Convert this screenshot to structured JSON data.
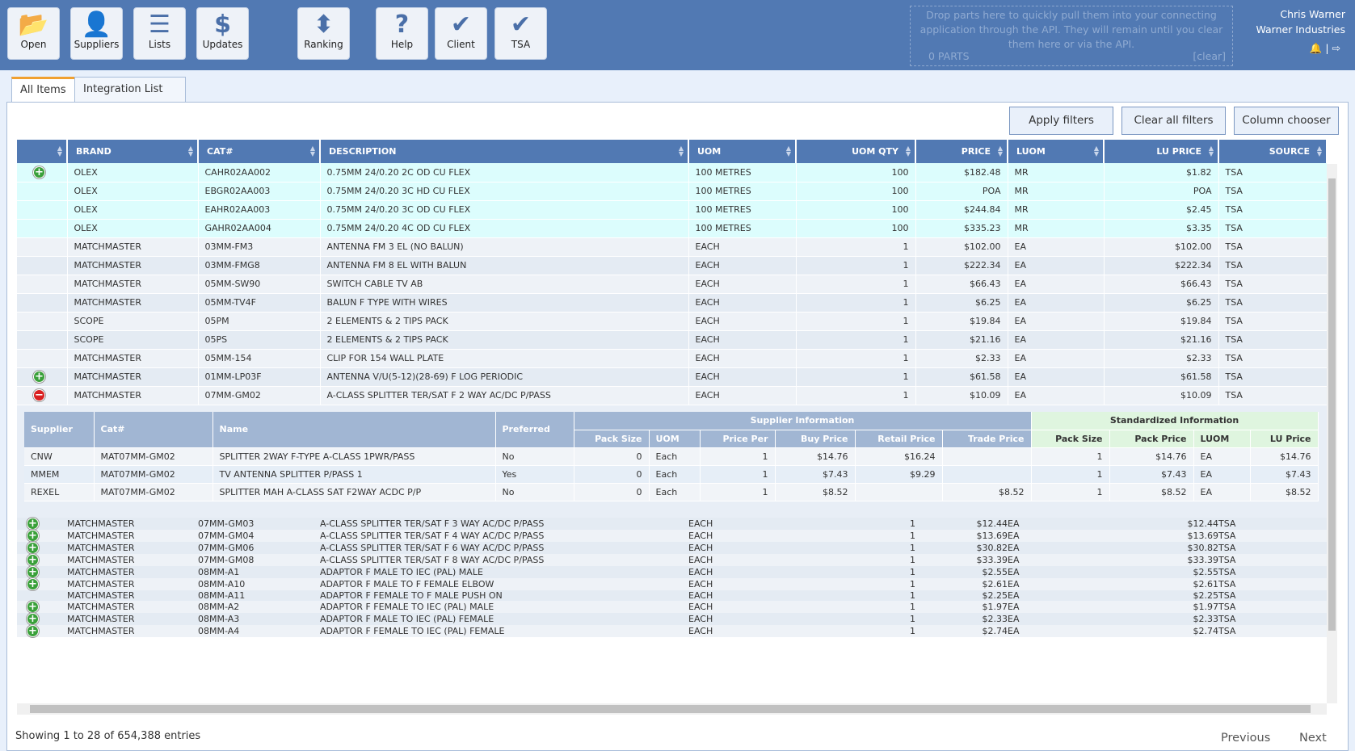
{
  "toolbar": {
    "buttons": [
      {
        "label": "Open",
        "icon": "folder-open-icon",
        "glyph": "📂"
      },
      {
        "label": "Suppliers",
        "icon": "user-icon",
        "glyph": "👤"
      },
      {
        "label": "Lists",
        "icon": "list-icon",
        "glyph": "☰"
      },
      {
        "label": "Updates",
        "icon": "dollar-icon",
        "glyph": "$"
      },
      {
        "label": "Ranking",
        "icon": "sort-icon",
        "glyph": "⬍"
      },
      {
        "label": "Help",
        "icon": "question-icon",
        "glyph": "?"
      },
      {
        "label": "Client",
        "icon": "check-icon",
        "glyph": "✔"
      },
      {
        "label": "TSA",
        "icon": "check-icon",
        "glyph": "✔"
      }
    ]
  },
  "dropzone": {
    "text": "Drop parts here to quickly pull them into your connecting application through the API. They will remain until you clear them here or via the API.",
    "count": "0 PARTS",
    "clear": "[clear]"
  },
  "user": {
    "name": "Chris Warner",
    "company": "Warner Industries",
    "bell": "🔔",
    "sep": "|",
    "logout": "⇨"
  },
  "tabs": {
    "all_items": "All Items",
    "integration_list": "Integration List",
    "chevron": "⌄"
  },
  "filters": {
    "apply": "Apply filters",
    "clear": "Clear all filters",
    "columns": "Column chooser"
  },
  "columns": [
    "",
    "BRAND",
    "CAT#",
    "DESCRIPTION",
    "UOM",
    "UOM QTY",
    "PRICE",
    "LUOM",
    "LU PRICE",
    "SOURCE"
  ],
  "rows_top": [
    {
      "icon": "plus",
      "brand": "OLEX",
      "cat": "CAHR02AA002",
      "desc": "0.75MM 24/0.20 2C OD CU FLEX",
      "uom": "100 METRES",
      "qty": "100",
      "price": "$182.48",
      "luom": "MR",
      "lu": "$1.82",
      "src": "TSA",
      "hl": true
    },
    {
      "icon": "",
      "brand": "OLEX",
      "cat": "EBGR02AA003",
      "desc": "0.75MM 24/0.20 3C HD CU FLEX",
      "uom": "100 METRES",
      "qty": "100",
      "price": "POA",
      "luom": "MR",
      "lu": "POA",
      "src": "TSA",
      "hl": true
    },
    {
      "icon": "",
      "brand": "OLEX",
      "cat": "EAHR02AA003",
      "desc": "0.75MM 24/0.20 3C OD CU FLEX",
      "uom": "100 METRES",
      "qty": "100",
      "price": "$244.84",
      "luom": "MR",
      "lu": "$2.45",
      "src": "TSA",
      "hl": true
    },
    {
      "icon": "",
      "brand": "OLEX",
      "cat": "GAHR02AA004",
      "desc": "0.75MM 24/0.20 4C OD CU FLEX",
      "uom": "100 METRES",
      "qty": "100",
      "price": "$335.23",
      "luom": "MR",
      "lu": "$3.35",
      "src": "TSA",
      "hl": true
    },
    {
      "icon": "",
      "brand": "MATCHMASTER",
      "cat": "03MM-FM3",
      "desc": "ANTENNA FM 3 EL (NO BALUN)",
      "uom": "EACH",
      "qty": "1",
      "price": "$102.00",
      "luom": "EA",
      "lu": "$102.00",
      "src": "TSA"
    },
    {
      "icon": "",
      "brand": "MATCHMASTER",
      "cat": "03MM-FMG8",
      "desc": "ANTENNA FM 8 EL WITH BALUN",
      "uom": "EACH",
      "qty": "1",
      "price": "$222.34",
      "luom": "EA",
      "lu": "$222.34",
      "src": "TSA"
    },
    {
      "icon": "",
      "brand": "MATCHMASTER",
      "cat": "05MM-SW90",
      "desc": "SWITCH CABLE TV AB",
      "uom": "EACH",
      "qty": "1",
      "price": "$66.43",
      "luom": "EA",
      "lu": "$66.43",
      "src": "TSA"
    },
    {
      "icon": "",
      "brand": "MATCHMASTER",
      "cat": "05MM-TV4F",
      "desc": "BALUN F TYPE WITH WIRES",
      "uom": "EACH",
      "qty": "1",
      "price": "$6.25",
      "luom": "EA",
      "lu": "$6.25",
      "src": "TSA"
    },
    {
      "icon": "",
      "brand": "SCOPE",
      "cat": "05PM",
      "desc": "2 ELEMENTS & 2 TIPS PACK",
      "uom": "EACH",
      "qty": "1",
      "price": "$19.84",
      "luom": "EA",
      "lu": "$19.84",
      "src": "TSA"
    },
    {
      "icon": "",
      "brand": "SCOPE",
      "cat": "05PS",
      "desc": "2 ELEMENTS & 2 TIPS PACK",
      "uom": "EACH",
      "qty": "1",
      "price": "$21.16",
      "luom": "EA",
      "lu": "$21.16",
      "src": "TSA"
    },
    {
      "icon": "",
      "brand": "MATCHMASTER",
      "cat": "05MM-154",
      "desc": "CLIP FOR 154 WALL PLATE",
      "uom": "EACH",
      "qty": "1",
      "price": "$2.33",
      "luom": "EA",
      "lu": "$2.33",
      "src": "TSA"
    },
    {
      "icon": "plus",
      "brand": "MATCHMASTER",
      "cat": "01MM-LP03F",
      "desc": "ANTENNA V/U(5-12)(28-69) F LOG PERIODIC",
      "uom": "EACH",
      "qty": "1",
      "price": "$61.58",
      "luom": "EA",
      "lu": "$61.58",
      "src": "TSA"
    },
    {
      "icon": "minus",
      "brand": "MATCHMASTER",
      "cat": "07MM-GM02",
      "desc": "A-CLASS SPLITTER TER/SAT F 2 WAY AC/DC P/PASS",
      "uom": "EACH",
      "qty": "1",
      "price": "$10.09",
      "luom": "EA",
      "lu": "$10.09",
      "src": "TSA"
    }
  ],
  "detail": {
    "group_supplier": "Supplier Information",
    "group_std": "Standardized Information",
    "headers": [
      "Supplier",
      "Cat#",
      "Name",
      "Preferred",
      "Pack Size",
      "UOM",
      "Price Per",
      "Buy Price",
      "Retail Price",
      "Trade Price",
      "Pack Size",
      "Pack Price",
      "LUOM",
      "LU Price"
    ],
    "rows": [
      [
        "CNW",
        "MAT07MM-GM02",
        "SPLITTER 2WAY F-TYPE A-CLASS 1PWR/PASS",
        "No",
        "0",
        "Each",
        "1",
        "$14.76",
        "$16.24",
        "",
        "1",
        "$14.76",
        "EA",
        "$14.76"
      ],
      [
        "MMEM",
        "MAT07MM-GM02",
        "TV ANTENNA SPLITTER P/PASS 1",
        "Yes",
        "0",
        "Each",
        "1",
        "$7.43",
        "$9.29",
        "",
        "1",
        "$7.43",
        "EA",
        "$7.43"
      ],
      [
        "REXEL",
        "MAT07MM-GM02",
        "SPLITTER MAH A-CLASS SAT F2WAY ACDC P/P",
        "No",
        "0",
        "Each",
        "1",
        "$8.52",
        "",
        "$8.52",
        "1",
        "$8.52",
        "EA",
        "$8.52"
      ]
    ]
  },
  "rows_bottom": [
    {
      "icon": "plus",
      "brand": "MATCHMASTER",
      "cat": "07MM-GM03",
      "desc": "A-CLASS SPLITTER TER/SAT F 3 WAY AC/DC P/PASS",
      "uom": "EACH",
      "qty": "1",
      "price": "$12.44",
      "luom": "EA",
      "lu": "$12.44",
      "src": "TSA"
    },
    {
      "icon": "plus",
      "brand": "MATCHMASTER",
      "cat": "07MM-GM04",
      "desc": "A-CLASS SPLITTER TER/SAT F 4 WAY AC/DC P/PASS",
      "uom": "EACH",
      "qty": "1",
      "price": "$13.69",
      "luom": "EA",
      "lu": "$13.69",
      "src": "TSA"
    },
    {
      "icon": "plus",
      "brand": "MATCHMASTER",
      "cat": "07MM-GM06",
      "desc": "A-CLASS SPLITTER TER/SAT F 6 WAY AC/DC P/PASS",
      "uom": "EACH",
      "qty": "1",
      "price": "$30.82",
      "luom": "EA",
      "lu": "$30.82",
      "src": "TSA"
    },
    {
      "icon": "plus",
      "brand": "MATCHMASTER",
      "cat": "07MM-GM08",
      "desc": "A-CLASS SPLITTER TER/SAT F 8 WAY AC/DC P/PASS",
      "uom": "EACH",
      "qty": "1",
      "price": "$33.39",
      "luom": "EA",
      "lu": "$33.39",
      "src": "TSA"
    },
    {
      "icon": "plus",
      "brand": "MATCHMASTER",
      "cat": "08MM-A1",
      "desc": "ADAPTOR F MALE TO IEC (PAL) MALE",
      "uom": "EACH",
      "qty": "1",
      "price": "$2.55",
      "luom": "EA",
      "lu": "$2.55",
      "src": "TSA"
    },
    {
      "icon": "plus",
      "brand": "MATCHMASTER",
      "cat": "08MM-A10",
      "desc": "ADAPTOR F MALE TO F FEMALE ELBOW",
      "uom": "EACH",
      "qty": "1",
      "price": "$2.61",
      "luom": "EA",
      "lu": "$2.61",
      "src": "TSA"
    },
    {
      "icon": "",
      "brand": "MATCHMASTER",
      "cat": "08MM-A11",
      "desc": "ADAPTOR F FEMALE TO F MALE PUSH ON",
      "uom": "EACH",
      "qty": "1",
      "price": "$2.25",
      "luom": "EA",
      "lu": "$2.25",
      "src": "TSA"
    },
    {
      "icon": "plus",
      "brand": "MATCHMASTER",
      "cat": "08MM-A2",
      "desc": "ADAPTOR F FEMALE TO IEC (PAL) MALE",
      "uom": "EACH",
      "qty": "1",
      "price": "$1.97",
      "luom": "EA",
      "lu": "$1.97",
      "src": "TSA"
    },
    {
      "icon": "plus",
      "brand": "MATCHMASTER",
      "cat": "08MM-A3",
      "desc": "ADAPTOR F MALE TO IEC (PAL) FEMALE",
      "uom": "EACH",
      "qty": "1",
      "price": "$2.33",
      "luom": "EA",
      "lu": "$2.33",
      "src": "TSA"
    },
    {
      "icon": "plus",
      "brand": "MATCHMASTER",
      "cat": "08MM-A4",
      "desc": "ADAPTOR F FEMALE TO IEC (PAL) FEMALE",
      "uom": "EACH",
      "qty": "1",
      "price": "$2.74",
      "luom": "EA",
      "lu": "$2.74",
      "src": "TSA"
    }
  ],
  "footer": {
    "info": "Showing 1 to 28 of 654,388 entries",
    "previous": "Previous",
    "next": "Next"
  }
}
